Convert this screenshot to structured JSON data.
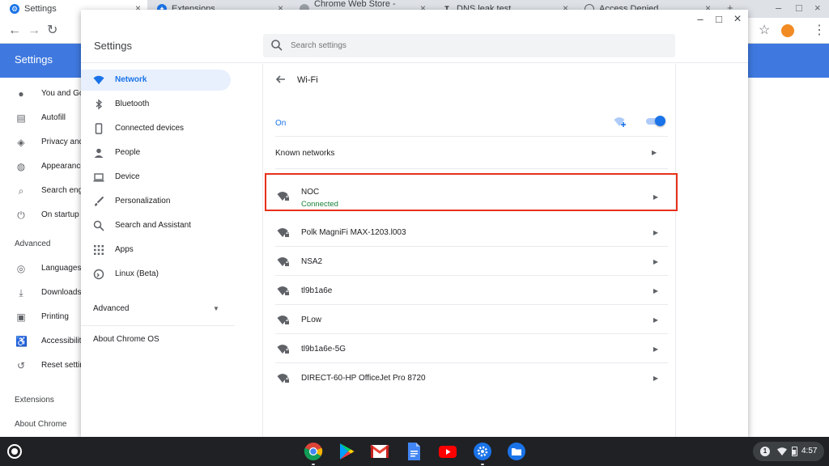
{
  "browser": {
    "tabs": [
      {
        "title": "Settings",
        "icon": "gear-icon"
      },
      {
        "title": "Extensions",
        "icon": "puzzle-icon"
      },
      {
        "title": "Chrome Web Store - cleanbrow",
        "icon": "web-store-icon"
      },
      {
        "title": "DNS leak test",
        "icon": "dns-icon"
      },
      {
        "title": "Access Denied",
        "icon": "globe-icon"
      }
    ],
    "new_tab": "+",
    "page_title": "Settings",
    "bg_menu": [
      {
        "label": "You and Goo",
        "icon": "person-icon"
      },
      {
        "label": "Autofill",
        "icon": "clipboard-icon"
      },
      {
        "label": "Privacy and",
        "icon": "shield-icon"
      },
      {
        "label": "Appearance",
        "icon": "palette-icon"
      },
      {
        "label": "Search engi",
        "icon": "search-icon"
      },
      {
        "label": "On startup",
        "icon": "power-icon"
      }
    ],
    "bg_advanced": "Advanced",
    "bg_menu_adv": [
      {
        "label": "Languages",
        "icon": "globe-icon"
      },
      {
        "label": "Downloads",
        "icon": "download-icon"
      },
      {
        "label": "Printing",
        "icon": "printer-icon"
      },
      {
        "label": "Accessibilit",
        "icon": "accessibility-icon"
      },
      {
        "label": "Reset settin",
        "icon": "reset-icon"
      }
    ],
    "bg_extensions": "Extensions",
    "bg_about": "About Chrome"
  },
  "dialog": {
    "title": "Settings",
    "search_placeholder": "Search settings",
    "controls": {
      "minimize": "–",
      "maximize": "□",
      "close": "×"
    }
  },
  "nav": {
    "items": [
      {
        "label": "Network",
        "icon": "wifi-icon"
      },
      {
        "label": "Bluetooth",
        "icon": "bluetooth-icon"
      },
      {
        "label": "Connected devices",
        "icon": "phone-icon"
      },
      {
        "label": "People",
        "icon": "person-icon"
      },
      {
        "label": "Device",
        "icon": "laptop-icon"
      },
      {
        "label": "Personalization",
        "icon": "brush-icon"
      },
      {
        "label": "Search and Assistant",
        "icon": "search-icon"
      },
      {
        "label": "Apps",
        "icon": "apps-grid-icon"
      },
      {
        "label": "Linux (Beta)",
        "icon": "linux-icon"
      }
    ],
    "advanced": "Advanced",
    "about": "About Chrome OS"
  },
  "wifi": {
    "title": "Wi-Fi",
    "state": "On",
    "enabled": true,
    "known_networks": "Known networks",
    "networks": [
      {
        "name": "NOC",
        "status": "Connected"
      },
      {
        "name": "Polk MagniFi MAX-1203.l003"
      },
      {
        "name": "NSA2"
      },
      {
        "name": "tl9b1a6e"
      },
      {
        "name": "PLow"
      },
      {
        "name": "tl9b1a6e-5G"
      },
      {
        "name": "DIRECT-60-HP OfficeJet Pro 8720"
      }
    ]
  },
  "shelf": {
    "apps": [
      "chrome-icon",
      "play-store-icon",
      "gmail-icon",
      "docs-icon",
      "youtube-icon",
      "settings-icon",
      "files-icon"
    ],
    "notification_count": "1",
    "time": "4:57"
  },
  "colors": {
    "accent": "#1a73e8",
    "header": "#3f79e0",
    "connected": "#188038",
    "highlight": "#e8311c"
  }
}
